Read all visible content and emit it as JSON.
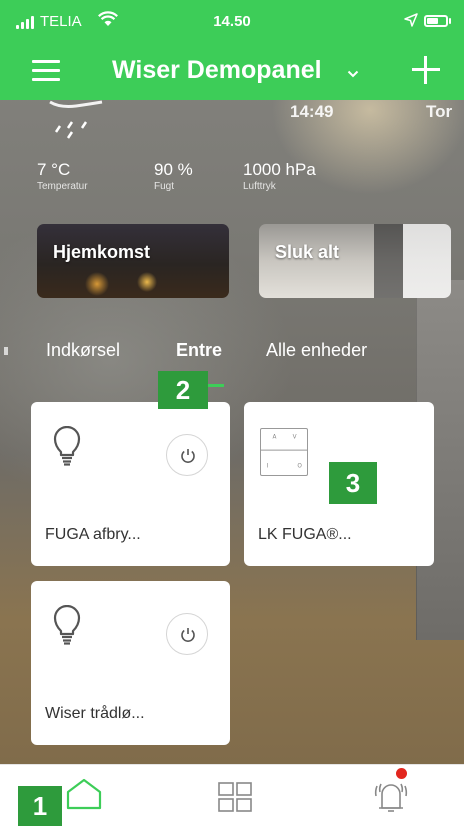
{
  "status_bar": {
    "carrier": "TELIA",
    "time": "14.50"
  },
  "header": {
    "title": "Wiser Demopanel",
    "title_chevron_icon": "chevron-down-icon",
    "menu_icon": "hamburger-icon",
    "add_icon": "plus-icon"
  },
  "weather": {
    "icon": "rain-cloud-icon",
    "clock_time": "14:49",
    "clock_day": "Tor",
    "stats": [
      {
        "value": "7 °C",
        "label": "Temperatur"
      },
      {
        "value": "90 %",
        "label": "Fugt"
      },
      {
        "value": "1000 hPa",
        "label": "Lufttryk"
      }
    ]
  },
  "scenes": [
    {
      "label": "Hjemkomst"
    },
    {
      "label": "Sluk alt"
    }
  ],
  "room_tabs": [
    {
      "label": "Indkørsel",
      "active": false
    },
    {
      "label": "Entre",
      "active": true
    },
    {
      "label": "Alle enheder",
      "active": false
    }
  ],
  "badges": {
    "one": "1",
    "two": "2",
    "three": "3"
  },
  "devices": [
    {
      "name": "FUGA afbry...",
      "icon": "lightbulb-icon",
      "action_icon": "power-icon"
    },
    {
      "name": "LK FUGA®...",
      "icon": "wall-switch-icon"
    },
    {
      "name": "Wiser trådlø...",
      "icon": "lightbulb-icon",
      "action_icon": "power-icon"
    }
  ],
  "bottom_nav": [
    {
      "icon": "home-icon",
      "active": true
    },
    {
      "icon": "grid-icon",
      "active": false
    },
    {
      "icon": "alarm-bell-icon",
      "active": false,
      "notification": true
    }
  ],
  "colors": {
    "accent": "#3dcd58",
    "badge": "#2e9b3c",
    "alert": "#e2261e"
  }
}
